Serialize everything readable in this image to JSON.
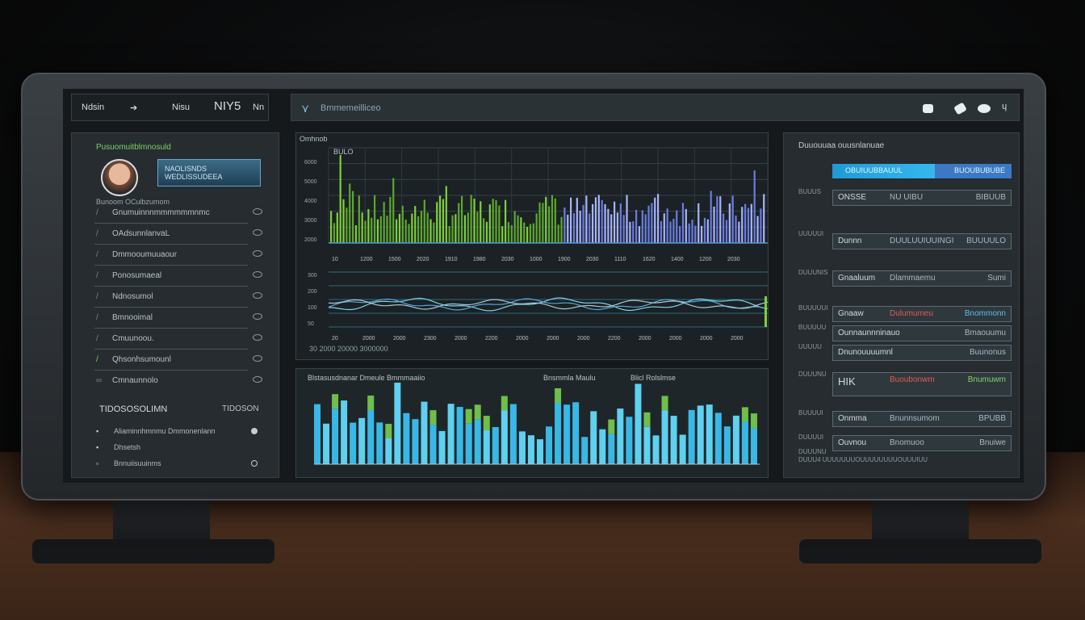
{
  "colors": {
    "accent_green": "#7fd36b",
    "accent_blue": "#3fb6ea",
    "accent_red": "#e15b50"
  },
  "topbar": {
    "left_items": [
      "Ndsin",
      "➔",
      "Nisu",
      "NIY5",
      "Nn"
    ],
    "title": "Bmmemeilliceo",
    "icons": [
      "camera-icon",
      "cloud-icon",
      "circle-icon",
      "power-icon"
    ]
  },
  "sidebar": {
    "heading": "Pusuomuitblmnosuld",
    "profile_button": "NAOLISNDS\nWEDLISSUDEEA",
    "subheading": "Bunoom OCulbzumom",
    "menu": [
      "Gnumuinnnmmmmmmnmc",
      "OAdsunnlanvaL",
      "Dmmooumuuaour",
      "Ponosumaeal",
      "Ndnosumol",
      "Bmnooimal",
      "Cmuunoou.",
      "Qhsonhsumounl",
      "Cmnaunnolo"
    ],
    "section_title": "TIDOSOSOLIMN",
    "section_right": "TIDOSON",
    "mini_rows": [
      "Aliaminnhmnmu Dmmonenlann",
      "Dhsetsh",
      "Bnnuiisuuinms"
    ]
  },
  "chartA": {
    "caption": "Omhnob",
    "inner_label": "BULO",
    "y_ticks": [
      "6000",
      "5000",
      "4000",
      "3000",
      "2000"
    ],
    "x_ticks": [
      "10",
      "1200",
      "1500",
      "2020",
      "1910",
      "1980",
      "2030",
      "1000",
      "1900",
      "2030",
      "1110",
      "1620",
      "1400",
      "1200",
      "2030"
    ],
    "line_y_ticks": [
      "300",
      "200",
      "100",
      "50"
    ],
    "line_x_ticks": [
      "20",
      "2000",
      "2000",
      "2300",
      "2000",
      "2200",
      "2000",
      "2000",
      "2000",
      "2200",
      "2000",
      "2000",
      "2000",
      "2000"
    ],
    "footer": "30 2000 20000 3000000"
  },
  "chartB": {
    "title": "Blstasusdnanar Dmeule Bmmmaaiio",
    "title_mid": "Bnsmmla Maulu",
    "title_right": "Blicl Rolslmse"
  },
  "rightp": {
    "title": "Duuouuaa ouusnlanuae",
    "progress_left": "OBUIUUBBAUUL",
    "progress_right": "BUOUBUBUBE",
    "progress_fraction": 0.58,
    "rows": [
      {
        "label": "ONSSE",
        "mid": "NU UIBU",
        "value": "BIBUUB"
      },
      {
        "label": "Dunnn",
        "mid": "DUULUUIUUINGI",
        "value": "BUUUULO"
      },
      {
        "label": "Gnaaluum",
        "mid": "Dlammaemu",
        "value": "Sumi"
      },
      {
        "label": "Gnaaw",
        "mid": "Dulumumeu",
        "value": "Bnommonn"
      },
      {
        "label": "Ounnaunnninauo",
        "mid": "",
        "value": "Bmaouumu"
      },
      {
        "label": "Dnunouuuumnl",
        "mid": "",
        "value": "Buunonus"
      },
      {
        "label": "HIK",
        "mid": "Buoubonwm",
        "value": "Bnumuwm"
      },
      {
        "label": "Onmma",
        "mid": "Bnunnsumom",
        "value": "BPUBB"
      },
      {
        "label": "Ouvnou",
        "mid": "Bnomuoo",
        "value": "Bnuiwe"
      }
    ],
    "left_labels": [
      "BUUUS",
      "UUUUUI",
      "DUUUNIS",
      "BUUUUUI",
      "BUUUUU",
      "UUUUU",
      "DUUUNU",
      "BUUUUI",
      "DUUUUI",
      "DUUUNU"
    ],
    "footer": "DUUU4 UUUUUUUOUUUUUUUUOUUUIUU"
  }
}
